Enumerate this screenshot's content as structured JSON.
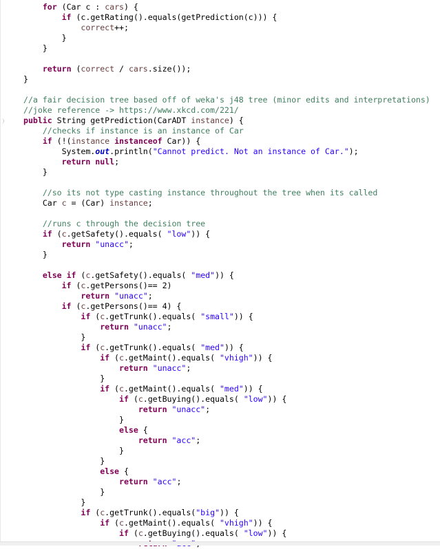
{
  "editor": {
    "language": "java",
    "colors": {
      "keyword": "#7f0055",
      "string": "#2a00ff",
      "comment": "#3f7f5f",
      "static_field": "#0000c0",
      "default": "#000000",
      "background": "#ffffff"
    },
    "lines": [
      {
        "indent": 1,
        "tokens": [
          [
            "kw",
            "for"
          ],
          [
            "t",
            " (Car c : "
          ],
          [
            "var",
            "cars"
          ],
          [
            "t",
            ") {"
          ]
        ]
      },
      {
        "indent": 2,
        "tokens": [
          [
            "kw",
            "if"
          ],
          [
            "t",
            " (c.getRating().equals(getPrediction(c))) {"
          ]
        ]
      },
      {
        "indent": 3,
        "tokens": [
          [
            "var",
            "correct"
          ],
          [
            "t",
            "++;"
          ]
        ]
      },
      {
        "indent": 2,
        "tokens": [
          [
            "t",
            "}"
          ]
        ]
      },
      {
        "indent": 1,
        "tokens": [
          [
            "t",
            "}"
          ]
        ]
      },
      {
        "indent": 0,
        "tokens": []
      },
      {
        "indent": 1,
        "tokens": [
          [
            "kw",
            "return"
          ],
          [
            "t",
            " ("
          ],
          [
            "var",
            "correct"
          ],
          [
            "t",
            " / "
          ],
          [
            "var",
            "cars"
          ],
          [
            "t",
            ".size());"
          ]
        ]
      },
      {
        "indent": 0,
        "tokens": [
          [
            "t",
            "}"
          ]
        ]
      },
      {
        "indent": 0,
        "tokens": []
      },
      {
        "indent": 0,
        "tokens": [
          [
            "cmt",
            "//a fair decision tree based off of weka's j48 tree (minor edits and interpretations)"
          ]
        ]
      },
      {
        "indent": 0,
        "tokens": [
          [
            "cmt",
            "//joke reference -> https://www.xkcd.com/221/"
          ]
        ]
      },
      {
        "indent": 0,
        "tokens": [
          [
            "kw",
            "public"
          ],
          [
            "t",
            " String getPrediction(CarADT "
          ],
          [
            "var",
            "instance"
          ],
          [
            "t",
            ") {"
          ]
        ]
      },
      {
        "indent": 1,
        "tokens": [
          [
            "cmt",
            "//checks if instance is an instance of Car"
          ]
        ]
      },
      {
        "indent": 1,
        "tokens": [
          [
            "kw",
            "if"
          ],
          [
            "t",
            " (!("
          ],
          [
            "var",
            "instance"
          ],
          [
            "t",
            " "
          ],
          [
            "kw",
            "instanceof"
          ],
          [
            "t",
            " Car)) {"
          ]
        ]
      },
      {
        "indent": 2,
        "tokens": [
          [
            "t",
            "System."
          ],
          [
            "fld",
            "out"
          ],
          [
            "t",
            ".println("
          ],
          [
            "str",
            "\"Cannot predict. Not an instance of Car.\""
          ],
          [
            "t",
            ");"
          ]
        ]
      },
      {
        "indent": 2,
        "tokens": [
          [
            "kw",
            "return"
          ],
          [
            "t",
            " "
          ],
          [
            "kw",
            "null"
          ],
          [
            "t",
            ";"
          ]
        ]
      },
      {
        "indent": 1,
        "tokens": [
          [
            "t",
            "}"
          ]
        ]
      },
      {
        "indent": 0,
        "tokens": []
      },
      {
        "indent": 1,
        "tokens": [
          [
            "cmt",
            "//so its not type casting instance throughout the tree when its called"
          ]
        ]
      },
      {
        "indent": 1,
        "tokens": [
          [
            "t",
            "Car "
          ],
          [
            "var",
            "c"
          ],
          [
            "t",
            " = (Car) "
          ],
          [
            "var",
            "instance"
          ],
          [
            "t",
            ";"
          ]
        ]
      },
      {
        "indent": 0,
        "tokens": []
      },
      {
        "indent": 1,
        "tokens": [
          [
            "cmt",
            "//runs c through the decision tree"
          ]
        ]
      },
      {
        "indent": 1,
        "tokens": [
          [
            "kw",
            "if"
          ],
          [
            "t",
            " ("
          ],
          [
            "var",
            "c"
          ],
          [
            "t",
            ".getSafety().equals( "
          ],
          [
            "str",
            "\"low\""
          ],
          [
            "t",
            ")) {"
          ]
        ]
      },
      {
        "indent": 2,
        "tokens": [
          [
            "kw",
            "return"
          ],
          [
            "t",
            " "
          ],
          [
            "str",
            "\"unacc\""
          ],
          [
            "t",
            ";"
          ]
        ]
      },
      {
        "indent": 1,
        "tokens": [
          [
            "t",
            "}"
          ]
        ]
      },
      {
        "indent": 0,
        "tokens": []
      },
      {
        "indent": 1,
        "tokens": [
          [
            "kw",
            "else"
          ],
          [
            "t",
            " "
          ],
          [
            "kw",
            "if"
          ],
          [
            "t",
            " ("
          ],
          [
            "var",
            "c"
          ],
          [
            "t",
            ".getSafety().equals( "
          ],
          [
            "str",
            "\"med\""
          ],
          [
            "t",
            ")) {"
          ]
        ]
      },
      {
        "indent": 2,
        "tokens": [
          [
            "kw",
            "if"
          ],
          [
            "t",
            " ("
          ],
          [
            "var",
            "c"
          ],
          [
            "t",
            ".getPersons()== 2)"
          ]
        ]
      },
      {
        "indent": 3,
        "tokens": [
          [
            "kw",
            "return"
          ],
          [
            "t",
            " "
          ],
          [
            "str",
            "\"unacc\""
          ],
          [
            "t",
            ";"
          ]
        ]
      },
      {
        "indent": 2,
        "tokens": [
          [
            "kw",
            "if"
          ],
          [
            "t",
            " ("
          ],
          [
            "var",
            "c"
          ],
          [
            "t",
            ".getPersons()== 4) {"
          ]
        ]
      },
      {
        "indent": 3,
        "tokens": [
          [
            "kw",
            "if"
          ],
          [
            "t",
            " ("
          ],
          [
            "var",
            "c"
          ],
          [
            "t",
            ".getTrunk().equals( "
          ],
          [
            "str",
            "\"small\""
          ],
          [
            "t",
            ")) {"
          ]
        ]
      },
      {
        "indent": 4,
        "tokens": [
          [
            "kw",
            "return"
          ],
          [
            "t",
            " "
          ],
          [
            "str",
            "\"unacc\""
          ],
          [
            "t",
            ";"
          ]
        ]
      },
      {
        "indent": 3,
        "tokens": [
          [
            "t",
            "}"
          ]
        ]
      },
      {
        "indent": 3,
        "tokens": [
          [
            "kw",
            "if"
          ],
          [
            "t",
            " ("
          ],
          [
            "var",
            "c"
          ],
          [
            "t",
            ".getTrunk().equals( "
          ],
          [
            "str",
            "\"med\""
          ],
          [
            "t",
            ")) {"
          ]
        ]
      },
      {
        "indent": 4,
        "tokens": [
          [
            "kw",
            "if"
          ],
          [
            "t",
            " ("
          ],
          [
            "var",
            "c"
          ],
          [
            "t",
            ".getMaint().equals( "
          ],
          [
            "str",
            "\"vhigh\""
          ],
          [
            "t",
            ")) {"
          ]
        ]
      },
      {
        "indent": 5,
        "tokens": [
          [
            "kw",
            "return"
          ],
          [
            "t",
            " "
          ],
          [
            "str",
            "\"unacc\""
          ],
          [
            "t",
            ";"
          ]
        ]
      },
      {
        "indent": 4,
        "tokens": [
          [
            "t",
            "}"
          ]
        ]
      },
      {
        "indent": 4,
        "tokens": [
          [
            "kw",
            "if"
          ],
          [
            "t",
            " ("
          ],
          [
            "var",
            "c"
          ],
          [
            "t",
            ".getMaint().equals( "
          ],
          [
            "str",
            "\"med\""
          ],
          [
            "t",
            ")) {"
          ]
        ]
      },
      {
        "indent": 5,
        "tokens": [
          [
            "kw",
            "if"
          ],
          [
            "t",
            " ("
          ],
          [
            "var",
            "c"
          ],
          [
            "t",
            ".getBuying().equals( "
          ],
          [
            "str",
            "\"low\""
          ],
          [
            "t",
            ")) {"
          ]
        ]
      },
      {
        "indent": 6,
        "tokens": [
          [
            "kw",
            "return"
          ],
          [
            "t",
            " "
          ],
          [
            "str",
            "\"unacc\""
          ],
          [
            "t",
            ";"
          ]
        ]
      },
      {
        "indent": 5,
        "tokens": [
          [
            "t",
            "}"
          ]
        ]
      },
      {
        "indent": 5,
        "tokens": [
          [
            "kw",
            "else"
          ],
          [
            "t",
            " {"
          ]
        ]
      },
      {
        "indent": 6,
        "tokens": [
          [
            "kw",
            "return"
          ],
          [
            "t",
            " "
          ],
          [
            "str",
            "\"acc\""
          ],
          [
            "t",
            ";"
          ]
        ]
      },
      {
        "indent": 5,
        "tokens": [
          [
            "t",
            "}"
          ]
        ]
      },
      {
        "indent": 4,
        "tokens": [
          [
            "t",
            "}"
          ]
        ]
      },
      {
        "indent": 4,
        "tokens": [
          [
            "kw",
            "else"
          ],
          [
            "t",
            " {"
          ]
        ]
      },
      {
        "indent": 5,
        "tokens": [
          [
            "kw",
            "return"
          ],
          [
            "t",
            " "
          ],
          [
            "str",
            "\"acc\""
          ],
          [
            "t",
            ";"
          ]
        ]
      },
      {
        "indent": 4,
        "tokens": [
          [
            "t",
            "}"
          ]
        ]
      },
      {
        "indent": 3,
        "tokens": [
          [
            "t",
            "}"
          ]
        ]
      },
      {
        "indent": 3,
        "tokens": [
          [
            "kw",
            "if"
          ],
          [
            "t",
            " ("
          ],
          [
            "var",
            "c"
          ],
          [
            "t",
            ".getTrunk().equals("
          ],
          [
            "str",
            "\"big\""
          ],
          [
            "t",
            ")) {"
          ]
        ]
      },
      {
        "indent": 4,
        "tokens": [
          [
            "kw",
            "if"
          ],
          [
            "t",
            " ("
          ],
          [
            "var",
            "c"
          ],
          [
            "t",
            ".getMaint().equals( "
          ],
          [
            "str",
            "\"vhigh\""
          ],
          [
            "t",
            ")) {"
          ]
        ]
      },
      {
        "indent": 5,
        "tokens": [
          [
            "kw",
            "if"
          ],
          [
            "t",
            " ("
          ],
          [
            "var",
            "c"
          ],
          [
            "t",
            ".getBuying().equals( "
          ],
          [
            "str",
            "\"low\""
          ],
          [
            "t",
            ")) {"
          ]
        ]
      },
      {
        "indent": 6,
        "tokens": [
          [
            "kw",
            "return"
          ],
          [
            "t",
            " "
          ],
          [
            "str",
            "\"acc\""
          ],
          [
            "t",
            ";"
          ]
        ]
      }
    ]
  }
}
